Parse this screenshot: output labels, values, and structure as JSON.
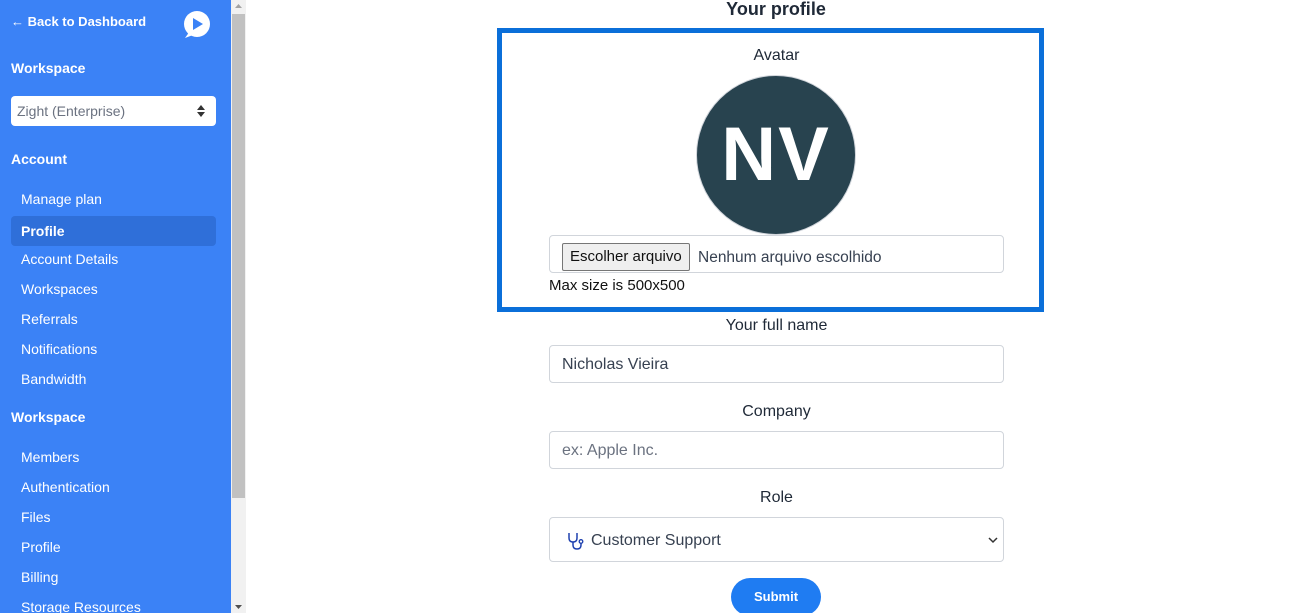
{
  "sidebar": {
    "back_label": "← Back to Dashboard",
    "workspace_heading": "Workspace",
    "workspace_select": "Zight (Enterprise)",
    "account_heading": "Account",
    "account_items": [
      {
        "label": "Manage plan"
      },
      {
        "label": "Profile"
      },
      {
        "label": "Account Details"
      },
      {
        "label": "Workspaces"
      },
      {
        "label": "Referrals"
      },
      {
        "label": "Notifications"
      },
      {
        "label": "Bandwidth"
      }
    ],
    "workspace_heading_2": "Workspace",
    "workspace_items": [
      {
        "label": "Members"
      },
      {
        "label": "Authentication"
      },
      {
        "label": "Files"
      },
      {
        "label": "Profile"
      },
      {
        "label": "Billing"
      },
      {
        "label": "Storage Resources"
      }
    ]
  },
  "main": {
    "title": "Your profile",
    "avatar_label": "Avatar",
    "avatar_initials": "NV",
    "file_button": "Escolher arquivo",
    "file_status": "Nenhum arquivo escolhido",
    "file_hint": "Max size is 500x500",
    "fullname_label": "Your full name",
    "fullname_value": "Nicholas Vieira",
    "company_label": "Company",
    "company_placeholder": "ex: Apple Inc.",
    "role_label": "Role",
    "role_value": "Customer Support",
    "submit_label": "Submit"
  },
  "colors": {
    "sidebar_bg": "#3b82f6",
    "active_item": "#2f6fd9",
    "highlight_border": "#0b6fd9",
    "avatar_bg": "#28434f",
    "submit_bg": "#1f7cf2"
  },
  "icons": {
    "logo": "zight-logo-icon",
    "select_arrows": "updown-arrows-icon",
    "role": "stethoscope-icon",
    "dropdown": "chevron-down-icon"
  }
}
